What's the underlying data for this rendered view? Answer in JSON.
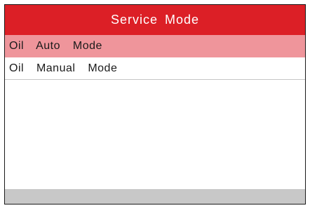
{
  "header": {
    "title": "Service Mode"
  },
  "menu": {
    "items": [
      {
        "label": "Oil  Auto  Mode",
        "selected": true
      },
      {
        "label": "Oil  Manual  Mode",
        "selected": false
      }
    ]
  },
  "colors": {
    "title_bar": "#dc1f26",
    "selected_row": "#ef959b",
    "status_bar": "#c8c8c8"
  }
}
